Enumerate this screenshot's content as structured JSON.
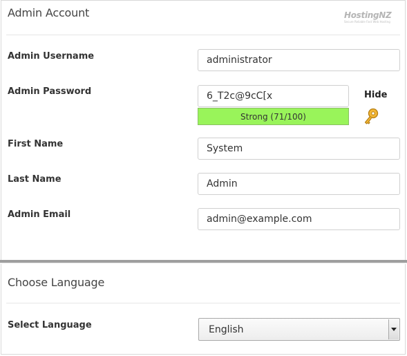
{
  "admin_section": {
    "title": "Admin Account",
    "logo": {
      "brand": "HostingNZ",
      "tagline": "Secure Reliable Fast Web Hosting"
    },
    "fields": {
      "username": {
        "label": "Admin Username",
        "value": "administrator"
      },
      "password": {
        "label": "Admin Password",
        "value": "6_T2c@9cC[x",
        "strength": "Strong (71/100)",
        "strength_score": 71,
        "strength_color": "#99f45a",
        "toggle": "Hide"
      },
      "first_name": {
        "label": "First Name",
        "value": "System"
      },
      "last_name": {
        "label": "Last Name",
        "value": "Admin"
      },
      "email": {
        "label": "Admin Email",
        "value": "admin@example.com"
      }
    },
    "icons": {
      "key": "key-icon"
    }
  },
  "language_section": {
    "title": "Choose Language",
    "select_label": "Select Language",
    "selected": "English"
  }
}
